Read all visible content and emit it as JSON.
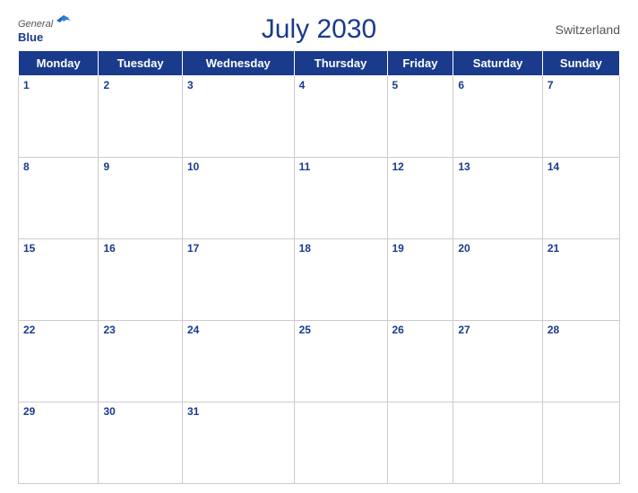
{
  "header": {
    "logo_general": "General",
    "logo_blue": "Blue",
    "title": "July 2030",
    "country": "Switzerland"
  },
  "days_of_week": [
    "Monday",
    "Tuesday",
    "Wednesday",
    "Thursday",
    "Friday",
    "Saturday",
    "Sunday"
  ],
  "weeks": [
    [
      1,
      2,
      3,
      4,
      5,
      6,
      7
    ],
    [
      8,
      9,
      10,
      11,
      12,
      13,
      14
    ],
    [
      15,
      16,
      17,
      18,
      19,
      20,
      21
    ],
    [
      22,
      23,
      24,
      25,
      26,
      27,
      28
    ],
    [
      29,
      30,
      31,
      null,
      null,
      null,
      null
    ]
  ]
}
